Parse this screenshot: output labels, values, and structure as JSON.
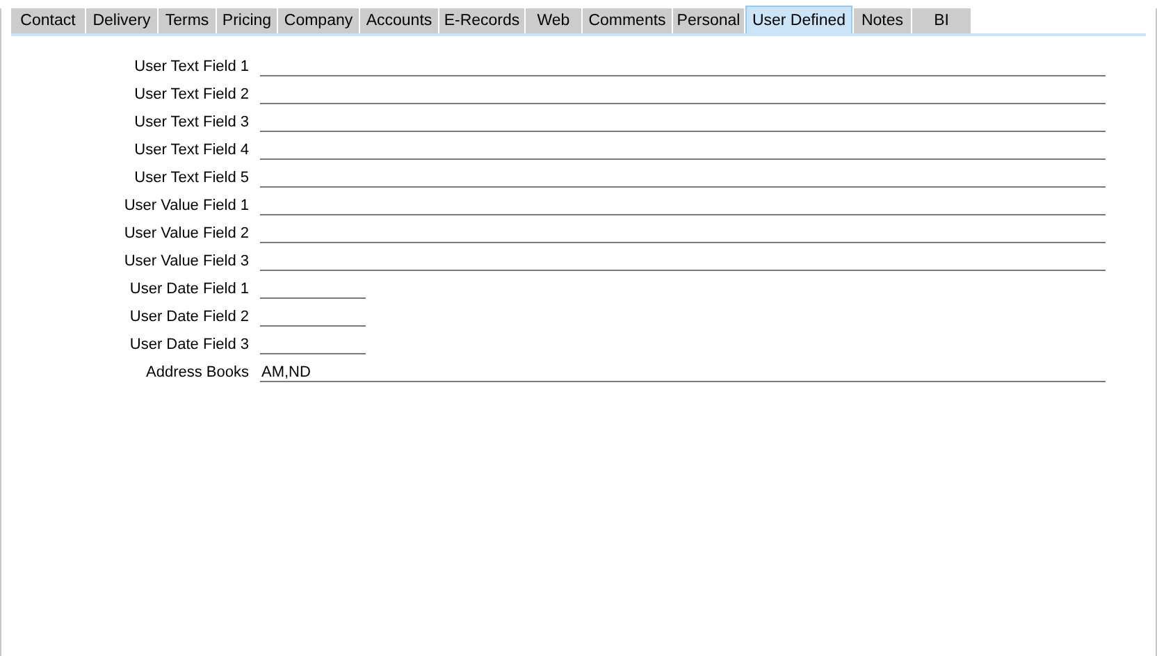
{
  "tabs": [
    {
      "label": "Contact",
      "selected": false
    },
    {
      "label": "Delivery",
      "selected": false
    },
    {
      "label": "Terms",
      "selected": false
    },
    {
      "label": "Pricing",
      "selected": false
    },
    {
      "label": "Company",
      "selected": false
    },
    {
      "label": "Accounts",
      "selected": false
    },
    {
      "label": "E-Records",
      "selected": false
    },
    {
      "label": "Web",
      "selected": false
    },
    {
      "label": "Comments",
      "selected": false
    },
    {
      "label": "Personal",
      "selected": false
    },
    {
      "label": "User Defined",
      "selected": true
    },
    {
      "label": "Notes",
      "selected": false
    },
    {
      "label": "BI",
      "selected": false
    }
  ],
  "fields": [
    {
      "label": "User Text Field 1",
      "kind": "long"
    },
    {
      "label": "User Text Field 2",
      "kind": "long"
    },
    {
      "label": "User Text Field 3",
      "kind": "long"
    },
    {
      "label": "User Text Field 4",
      "kind": "long"
    },
    {
      "label": "User Text Field 5",
      "kind": "long"
    },
    {
      "label": "User Value Field 1",
      "kind": "long"
    },
    {
      "label": "User Value Field 2",
      "kind": "long"
    },
    {
      "label": "User Value Field 3",
      "kind": "long"
    },
    {
      "label": "User Date Field 1",
      "kind": "short"
    },
    {
      "label": "User Date Field 2",
      "kind": "short"
    },
    {
      "label": "User Date Field 3",
      "kind": "short"
    },
    {
      "label": "Address Books",
      "kind": "long",
      "value": "AM,ND"
    }
  ]
}
